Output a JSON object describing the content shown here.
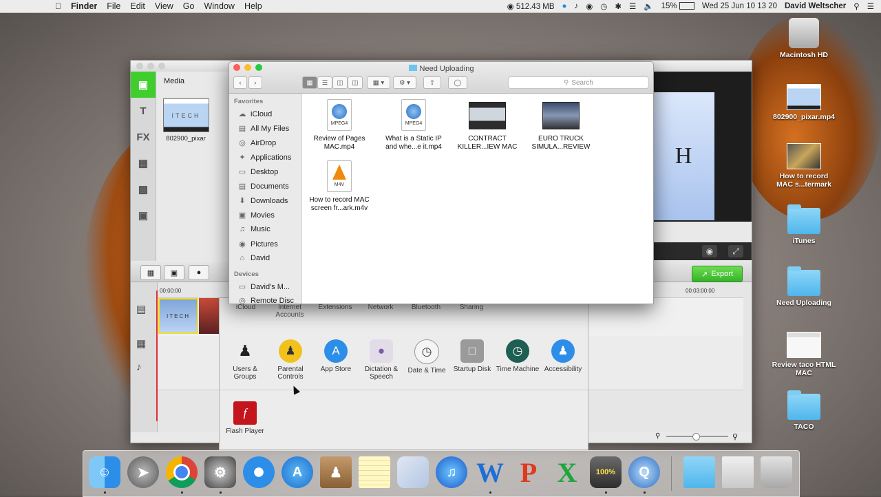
{
  "menubar": {
    "apple": "",
    "app": "Finder",
    "menus": [
      "File",
      "Edit",
      "View",
      "Go",
      "Window",
      "Help"
    ],
    "memory": "512.43 MB",
    "battery": "15%",
    "datetime": "Wed 25 Jun  10 13 20",
    "user": "David Weltscher"
  },
  "desktop": {
    "items": [
      {
        "label": "Macintosh HD",
        "icon": "hard-drive-icon"
      },
      {
        "label": "802900_pixar.mp4",
        "icon": "video-thumbnail-icon"
      },
      {
        "label": "How to record MAC s...termark",
        "icon": "video-thumbnail-icon"
      },
      {
        "label": "iTunes",
        "icon": "folder-icon"
      },
      {
        "label": "Need Uploading",
        "icon": "folder-icon"
      },
      {
        "label": "Review taco HTML MAC",
        "icon": "screenshot-thumbnail-icon"
      },
      {
        "label": "TACO",
        "icon": "folder-icon"
      }
    ]
  },
  "editor": {
    "sidebar": [
      "T",
      "FX"
    ],
    "media_label": "Media",
    "media_clip_text": "ITECH",
    "media_clip_caption": "802900_pixar",
    "preview_letter": "H",
    "timecode_start": "00:00:00",
    "timecode_mid": "00:03:00:00",
    "export_label": "Export",
    "clip_text": "ITECH"
  },
  "sysprefs": {
    "top_row": [
      "iCloud",
      "Internet Accounts",
      "Extensions",
      "Network",
      "Bluetooth",
      "Sharing"
    ],
    "row": [
      {
        "label": "Users & Groups",
        "icon": "users-groups-icon"
      },
      {
        "label": "Parental Controls",
        "icon": "parental-controls-icon"
      },
      {
        "label": "App Store",
        "icon": "app-store-icon"
      },
      {
        "label": "Dictation & Speech",
        "icon": "microphone-icon"
      },
      {
        "label": "Date & Time",
        "icon": "clock-icon"
      },
      {
        "label": "Startup Disk",
        "icon": "startup-disk-icon"
      },
      {
        "label": "Time Machine",
        "icon": "time-machine-icon"
      },
      {
        "label": "Accessibility",
        "icon": "accessibility-icon"
      }
    ],
    "other": [
      {
        "label": "Flash Player",
        "icon": "flash-player-icon"
      }
    ]
  },
  "finder": {
    "title": "Need Uploading",
    "search_placeholder": "Search",
    "sidebar": {
      "favorites_header": "Favorites",
      "favorites": [
        {
          "label": "iCloud",
          "icon": "cloud-icon"
        },
        {
          "label": "All My Files",
          "icon": "all-files-icon"
        },
        {
          "label": "AirDrop",
          "icon": "airdrop-icon"
        },
        {
          "label": "Applications",
          "icon": "applications-icon"
        },
        {
          "label": "Desktop",
          "icon": "desktop-icon"
        },
        {
          "label": "Documents",
          "icon": "documents-icon"
        },
        {
          "label": "Downloads",
          "icon": "downloads-icon"
        },
        {
          "label": "Movies",
          "icon": "movies-icon"
        },
        {
          "label": "Music",
          "icon": "music-icon"
        },
        {
          "label": "Pictures",
          "icon": "pictures-icon"
        },
        {
          "label": "David",
          "icon": "home-icon"
        }
      ],
      "devices_header": "Devices",
      "devices": [
        {
          "label": "David's M...",
          "icon": "laptop-icon"
        },
        {
          "label": "Remote Disc",
          "icon": "disc-icon"
        }
      ]
    },
    "files": [
      {
        "line1": "Review of Pages",
        "line2": "MAC.mp4",
        "badge": "MPEG4",
        "kind": "mpeg4"
      },
      {
        "line1": "What is a Static IP",
        "line2": "and whe...e it.mp4",
        "badge": "MPEG4",
        "kind": "mpeg4"
      },
      {
        "line1": "CONTRACT",
        "line2": "KILLER...IEW MAC",
        "badge": "",
        "kind": "video"
      },
      {
        "line1": "EURO TRUCK",
        "line2": "SIMULA...REVIEW",
        "badge": "",
        "kind": "video"
      },
      {
        "line1": "How to record MAC",
        "line2": "screen fr...ark.m4v",
        "badge": "M4V",
        "kind": "m4v"
      }
    ]
  },
  "dock": {
    "apps": [
      "finder",
      "launchpad",
      "chrome",
      "system-preferences",
      "safari",
      "app-store",
      "contacts",
      "notes",
      "preview",
      "itunes",
      "word",
      "powerpoint",
      "excel",
      "battery-monitor",
      "quicktime",
      "downloads-stack",
      "documents-stack",
      "trash"
    ],
    "battery_badge": "100%"
  }
}
